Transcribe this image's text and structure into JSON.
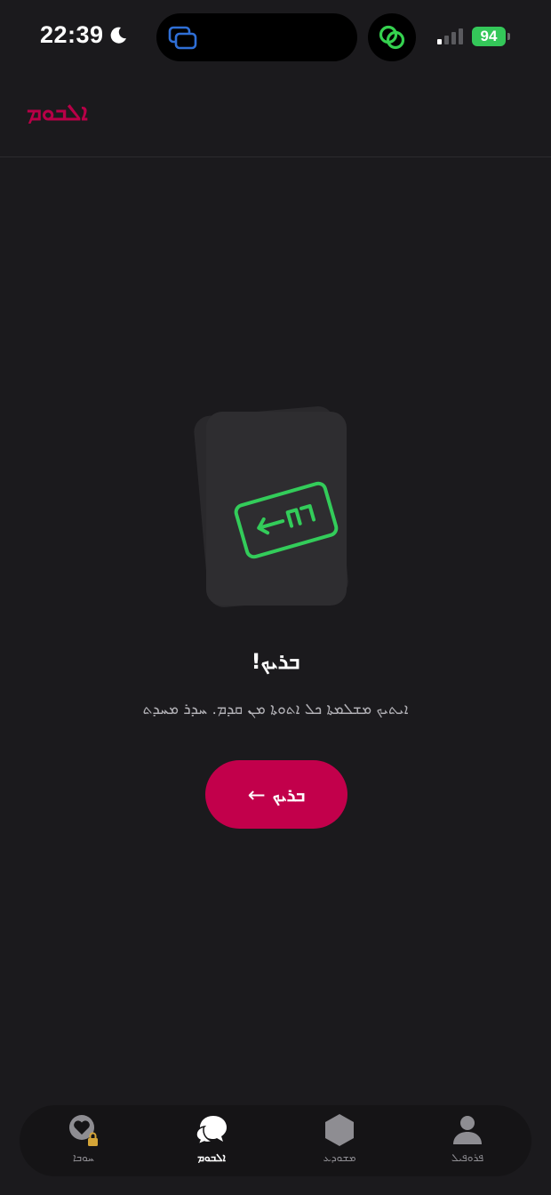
{
  "status_bar": {
    "time": "22:39",
    "battery": "94",
    "moon_icon": "moon-icon",
    "signal_icon": "signal-icon"
  },
  "header": {
    "title": "ܐܠܒܘܡ"
  },
  "empty_state": {
    "title": "ܒܪܝܟ!",
    "description": "ܐܝܬܝܟ ܡܫܠܡܬܐ ܟܠ ܐܬܘܬܐ ܡܢ ܩܕܡ. ܚܕܪ ܡܚܕܬ",
    "button_label": "ܒܪܝܟ",
    "button_icon": "arrow-left-icon",
    "accent_color": "#c2004b"
  },
  "tabs": [
    {
      "label": "ܚܘܒܐ",
      "icon": "heart-lock-icon",
      "active": false
    },
    {
      "label": "ܐܠܒܘܡ",
      "icon": "chat-bubbles-icon",
      "active": true
    },
    {
      "label": "ܡܫܘܕܥ",
      "icon": "hexagon-icon",
      "active": false
    },
    {
      "label": "ܦܪܘܦܝܠ",
      "icon": "person-icon",
      "active": false
    }
  ]
}
